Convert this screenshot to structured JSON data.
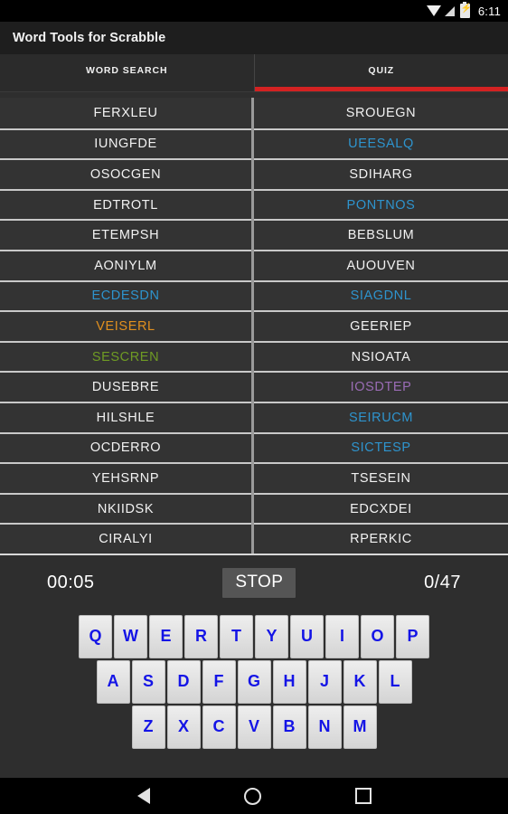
{
  "statusbar": {
    "time": "6:11",
    "icons": [
      "wifi-icon",
      "signal-icon",
      "battery-charging-icon"
    ]
  },
  "appbar": {
    "title": "Word Tools for Scrabble"
  },
  "tabs": [
    {
      "label": "WORD SEARCH",
      "active": false
    },
    {
      "label": "QUIZ",
      "active": true
    }
  ],
  "accent_color": "#d32222",
  "word_colors": {
    "default": "#f2f2f2",
    "blue": "#2e94ce",
    "orange": "#e2901e",
    "green": "#6f9b24",
    "purple": "#9a6cb5"
  },
  "word_list": {
    "left_column": [
      {
        "text": "FERXLEU",
        "color": "default"
      },
      {
        "text": "IUNGFDE",
        "color": "default"
      },
      {
        "text": "OSOCGEN",
        "color": "default"
      },
      {
        "text": "EDTROTL",
        "color": "default"
      },
      {
        "text": "ETEMPSH",
        "color": "default"
      },
      {
        "text": "AONIYLM",
        "color": "default"
      },
      {
        "text": "ECDESDN",
        "color": "blue"
      },
      {
        "text": "VEISERL",
        "color": "orange"
      },
      {
        "text": "SESCREN",
        "color": "green"
      },
      {
        "text": "DUSEBRE",
        "color": "default"
      },
      {
        "text": "HILSHLE",
        "color": "default"
      },
      {
        "text": "OCDERRO",
        "color": "default"
      },
      {
        "text": "YEHSRNP",
        "color": "default"
      },
      {
        "text": "NKIIDSK",
        "color": "default"
      },
      {
        "text": "CIRALYI",
        "color": "default"
      }
    ],
    "right_column": [
      {
        "text": "SROUEGN",
        "color": "default"
      },
      {
        "text": "UEESALQ",
        "color": "blue"
      },
      {
        "text": "SDIHARG",
        "color": "default"
      },
      {
        "text": "PONTNOS",
        "color": "blue"
      },
      {
        "text": "BEBSLUM",
        "color": "default"
      },
      {
        "text": "AUOUVEN",
        "color": "default"
      },
      {
        "text": "SIAGDNL",
        "color": "blue"
      },
      {
        "text": "GEERIEP",
        "color": "default"
      },
      {
        "text": "NSIOATA",
        "color": "default"
      },
      {
        "text": "IOSDTEP",
        "color": "purple"
      },
      {
        "text": "SEIRUCM",
        "color": "blue"
      },
      {
        "text": "SICTESP",
        "color": "blue"
      },
      {
        "text": "TSESEIN",
        "color": "default"
      },
      {
        "text": "EDCXDEI",
        "color": "default"
      },
      {
        "text": "RPERKIC",
        "color": "default"
      }
    ]
  },
  "scorebar": {
    "timer": "00:05",
    "stop_label": "STOP",
    "score": "0/47"
  },
  "keyboard": {
    "rows": [
      [
        "Q",
        "W",
        "E",
        "R",
        "T",
        "Y",
        "U",
        "I",
        "O",
        "P"
      ],
      [
        "A",
        "S",
        "D",
        "F",
        "G",
        "H",
        "J",
        "K",
        "L"
      ],
      [
        "Z",
        "X",
        "C",
        "V",
        "B",
        "N",
        "M"
      ]
    ]
  },
  "navbar": {
    "items": [
      "back-icon",
      "home-icon",
      "recent-apps-icon"
    ]
  }
}
